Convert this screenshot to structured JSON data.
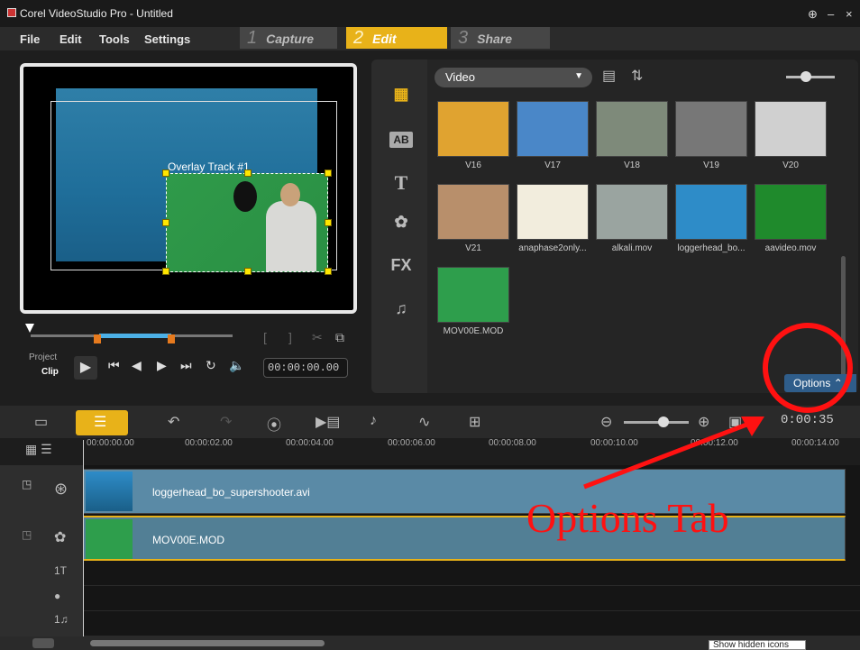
{
  "window": {
    "title": "Corel VideoStudio Pro - Untitled",
    "controls": [
      "⊕",
      "–",
      "×"
    ]
  },
  "menu": [
    "File",
    "Edit",
    "Tools",
    "Settings"
  ],
  "steps": [
    {
      "num": "1",
      "label": "Capture"
    },
    {
      "num": "2",
      "label": "Edit"
    },
    {
      "num": "3",
      "label": "Share"
    }
  ],
  "preview": {
    "overlay_label": "Overlay Track #1",
    "project_label": "Project",
    "clip_label": "Clip",
    "timecode": "00:00:00.00"
  },
  "library": {
    "dropdown": "Video",
    "options_label": "Options"
  },
  "thumbs": [
    {
      "label": "V16",
      "color": "#e0a330"
    },
    {
      "label": "V17",
      "color": "#4a87c8"
    },
    {
      "label": "V18",
      "color": "#7e8a7a"
    },
    {
      "label": "V19",
      "color": "#777"
    },
    {
      "label": "V20",
      "color": "#d0d0d0"
    },
    {
      "label": "V21",
      "color": "#b88f6b"
    },
    {
      "label": "anaphase2only...",
      "color": "#f2eddd"
    },
    {
      "label": "alkali.mov",
      "color": "#9aa4a0"
    },
    {
      "label": "loggerhead_bo...",
      "color": "#2e8cc8"
    },
    {
      "label": "aavideo.mov",
      "color": "#1f8a2c"
    },
    {
      "label": "MOV00E.MOD",
      "color": "#2e9e4c"
    }
  ],
  "ruler": [
    "00:00:00.00",
    "00:00:02.00",
    "00:00:04.00",
    "00:00:06.00",
    "00:00:08.00",
    "00:00:10.00",
    "00:00:12.00",
    "00:00:14.00"
  ],
  "timeline_time": "0:00:35",
  "clips": [
    {
      "label": "loggerhead_bo_supershooter.avi"
    },
    {
      "label": "MOV00E.MOD"
    }
  ],
  "annotation": "Options Tab",
  "tooltip": "Show hidden icons"
}
